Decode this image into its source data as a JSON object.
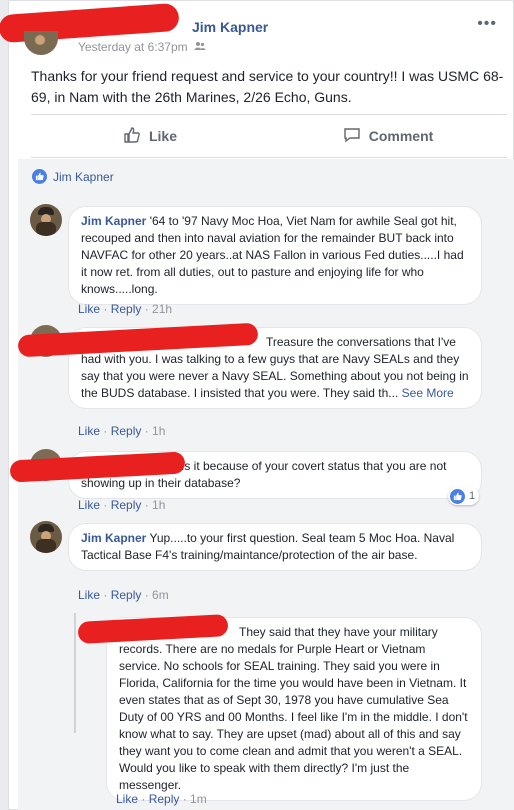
{
  "post": {
    "author": "Jim Kapner",
    "time": "Yesterday at 6:37pm",
    "audience_icon": "friends-icon",
    "text": "Thanks for your friend request and service to your country!! I was USMC 68-69, in Nam with the 26th Marines, 2/26 Echo, Guns."
  },
  "actions": {
    "like": "Like",
    "comment": "Comment"
  },
  "likes": {
    "name": "Jim Kapner"
  },
  "comments": [
    {
      "author": "Jim Kapner",
      "text": "'64 to '97 Navy Moc Hoa, Viet Nam for awhile Seal got hit, recouped and then into naval aviation for the remainder BUT back into NAVFAC for other 20 years..at NAS Fallon in various Fed duties.....I had it now ret. from all duties, out to pasture and enjoying life for who knows.....long.",
      "like": "Like",
      "reply": "Reply",
      "age": "21h"
    },
    {
      "author": "",
      "text": "Treasure the conversations that I've had with you. I was talking to a few guys that are Navy SEALs and they say that you were never a Navy SEAL. Something about you not being in the BUDS database. I insisted that you were. They said th...",
      "see_more": "See More",
      "like": "Like",
      "reply": "Reply",
      "age": "1h"
    },
    {
      "author": "",
      "text": "Is it because of your covert status that you are not showing up in their database?",
      "like": "Like",
      "reply": "Reply",
      "age": "1h",
      "reactions": "1"
    },
    {
      "author": "Jim Kapner",
      "text": "Yup.....to your first question. Seal team 5 Moc Hoa. Naval Tactical Base F4's training/maintance/protection of the air base.",
      "like": "Like",
      "reply": "Reply",
      "age": "6m"
    },
    {
      "author": "",
      "text": "They said that they have your military records. There are no medals for Purple Heart or Vietnam service. No schools for SEAL training. They said you were in Florida, California for the time you would have been in Vietnam. It even states that as of Sept 30, 1978 you have cumulative Sea Duty of 00 YRS and 00 Months. I feel like I'm in the middle. I don't know what to say. They are upset (mad) about all of this and say they want you to come clean and admit that you weren't a SEAL. Would you like to speak with them directly? I'm just the messenger.",
      "like": "Like",
      "reply": "Reply",
      "age": "1m"
    }
  ],
  "colors": {
    "link": "#385898",
    "meta": "#90949c",
    "redaction": "#e8201f",
    "like_blue": "#4a7fe6"
  }
}
